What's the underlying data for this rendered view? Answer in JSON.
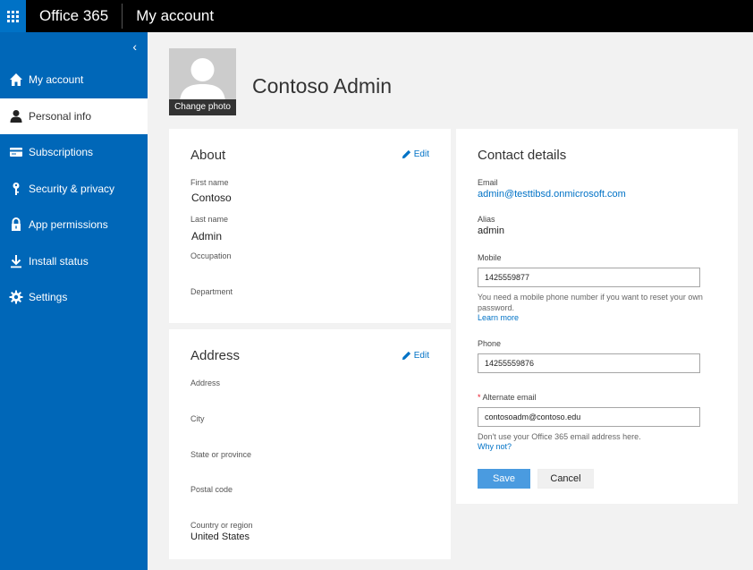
{
  "topbar": {
    "brand": "Office 365",
    "page_title": "My account"
  },
  "sidebar": {
    "collapse_glyph": "‹",
    "items": [
      {
        "label": "My account",
        "icon": "home-icon",
        "active": false
      },
      {
        "label": "Personal info",
        "icon": "person-icon",
        "active": true
      },
      {
        "label": "Subscriptions",
        "icon": "card-icon",
        "active": false
      },
      {
        "label": "Security & privacy",
        "icon": "key-icon",
        "active": false
      },
      {
        "label": "App permissions",
        "icon": "lock-icon",
        "active": false
      },
      {
        "label": "Install status",
        "icon": "download-icon",
        "active": false
      },
      {
        "label": "Settings",
        "icon": "gear-icon",
        "active": false
      }
    ]
  },
  "profile": {
    "name": "Contoso Admin",
    "change_photo": "Change photo"
  },
  "about": {
    "title": "About",
    "edit": "Edit",
    "first_name_label": "First name",
    "first_name": "Contoso",
    "last_name_label": "Last name",
    "last_name": "Admin",
    "occupation_label": "Occupation",
    "department_label": "Department"
  },
  "address": {
    "title": "Address",
    "edit": "Edit",
    "address_label": "Address",
    "city_label": "City",
    "state_label": "State or province",
    "postal_label": "Postal code",
    "country_label": "Country or region",
    "country": "United States"
  },
  "contact": {
    "title": "Contact details",
    "email_label": "Email",
    "email": "admin@testtibsd.onmicrosoft.com",
    "alias_label": "Alias",
    "alias": "admin",
    "mobile_label": "Mobile",
    "mobile": "1425559877",
    "mobile_help": "You need a mobile phone number if you want to reset your own password.",
    "learn_more": "Learn more",
    "phone_label": "Phone",
    "phone": "14255559876",
    "required_mark": "*",
    "alt_email_label": "Alternate email",
    "alt_email": "contosoadm@contoso.edu",
    "alt_email_help": "Don't use your Office 365 email address here.",
    "why_not": "Why not?",
    "save": "Save",
    "cancel": "Cancel"
  },
  "colors": {
    "brand_blue": "#0072c6",
    "sidebar_blue": "#0067b8",
    "save_blue": "#4a9be0"
  }
}
